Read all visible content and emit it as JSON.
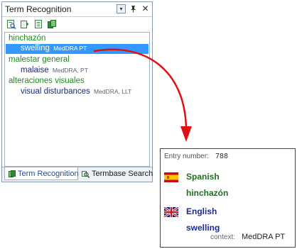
{
  "pane": {
    "title": "Term Recognition",
    "header_buttons": {
      "dropdown": "▾",
      "pin": "ᵖ",
      "close": "✕"
    },
    "toolbar_icons": [
      "search-terms-icon",
      "open-termbase-icon",
      "add-term-icon",
      "termbase-settings-icon"
    ],
    "entries": [
      {
        "source": "hinchazón",
        "target": "swelling",
        "target_src": "MedDRA PT",
        "selected": true
      },
      {
        "source": "malestar general",
        "target": "malaise",
        "target_src": "MedDRA, PT",
        "selected": false
      },
      {
        "source": "alteraciones visuales",
        "target": "visual disturbances",
        "target_src": "MedDRA, LLT",
        "selected": false
      }
    ],
    "tabs": [
      {
        "label": "Term Recognition",
        "active": true,
        "icon": "term-recognition-icon"
      },
      {
        "label": "Termbase Search",
        "active": false,
        "icon": "termbase-search-icon"
      }
    ]
  },
  "detail": {
    "entry_number_label": "Entry number:",
    "entry_number_value": "788",
    "languages": [
      {
        "language": "Spanish",
        "flag": "spain-flag",
        "term": "hinchazón"
      },
      {
        "language": "English",
        "flag": "uk-flag",
        "term": "swelling"
      }
    ],
    "context_label": "context:",
    "context_value": "MedDRA PT"
  },
  "colors": {
    "source_term": "#1f8a1f",
    "target_term": "#1b2a7a",
    "selection": "#3399ff",
    "arrow": "#e01010"
  }
}
